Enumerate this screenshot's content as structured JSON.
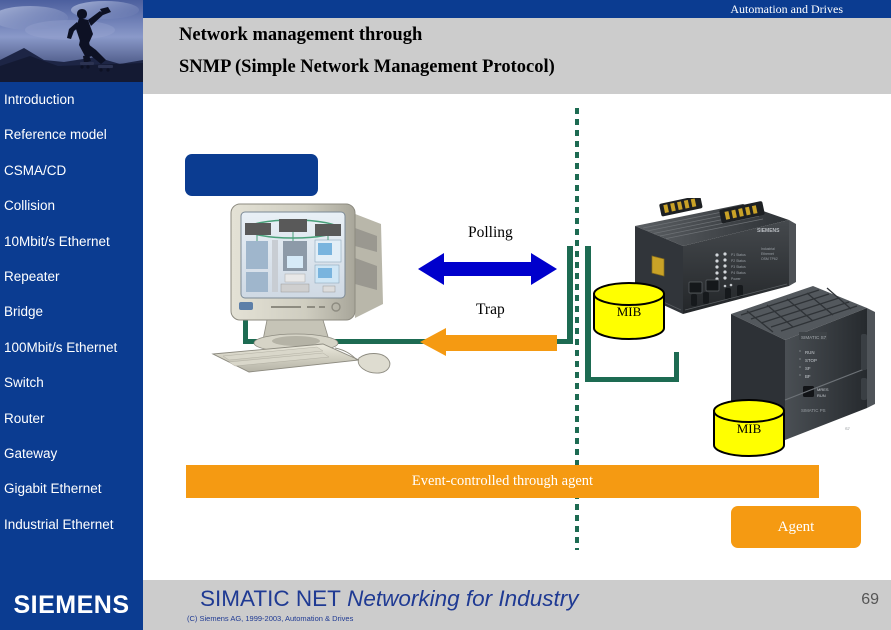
{
  "header": {
    "corporate_label": "Automation and Drives",
    "title_line1": "Network management through",
    "title_line2": "SNMP (Simple Network Management Protocol)"
  },
  "sidebar": {
    "brand": "SIEMENS",
    "items": [
      {
        "label": "Introduction"
      },
      {
        "label": "Reference model"
      },
      {
        "label": "CSMA/CD"
      },
      {
        "label": "Collision"
      },
      {
        "label": "10Mbit/s Ethernet"
      },
      {
        "label": "Repeater"
      },
      {
        "label": "Bridge"
      },
      {
        "label": "100Mbit/s Ethernet"
      },
      {
        "label": "Switch"
      },
      {
        "label": "Router"
      },
      {
        "label": "Gateway"
      },
      {
        "label": "Gigabit Ethernet"
      },
      {
        "label": "Industrial Ethernet"
      }
    ]
  },
  "diagram": {
    "polling_label": "Polling",
    "trap_label": "Trap",
    "mib_top_label": "MIB",
    "mib_bottom_label": "MIB",
    "event_banner": "Event-controlled through agent",
    "agent_label": "Agent",
    "blue_box_label": ""
  },
  "footer": {
    "product": "SIMATIC NET",
    "tagline": "Networking for Industry",
    "copyright": "(C) Siemens AG, 1999-2003, Automation & Drives",
    "page_number": "69"
  },
  "colors": {
    "siemens_blue": "#0b3c91",
    "header_gray": "#cccccc",
    "polling_arrow_blue": "#0000cc",
    "trap_arrow_orange": "#f59a12",
    "bus_green": "#1d6b52",
    "mib_yellow": "#ffff00",
    "footer_text_blue": "#1f3a93"
  }
}
